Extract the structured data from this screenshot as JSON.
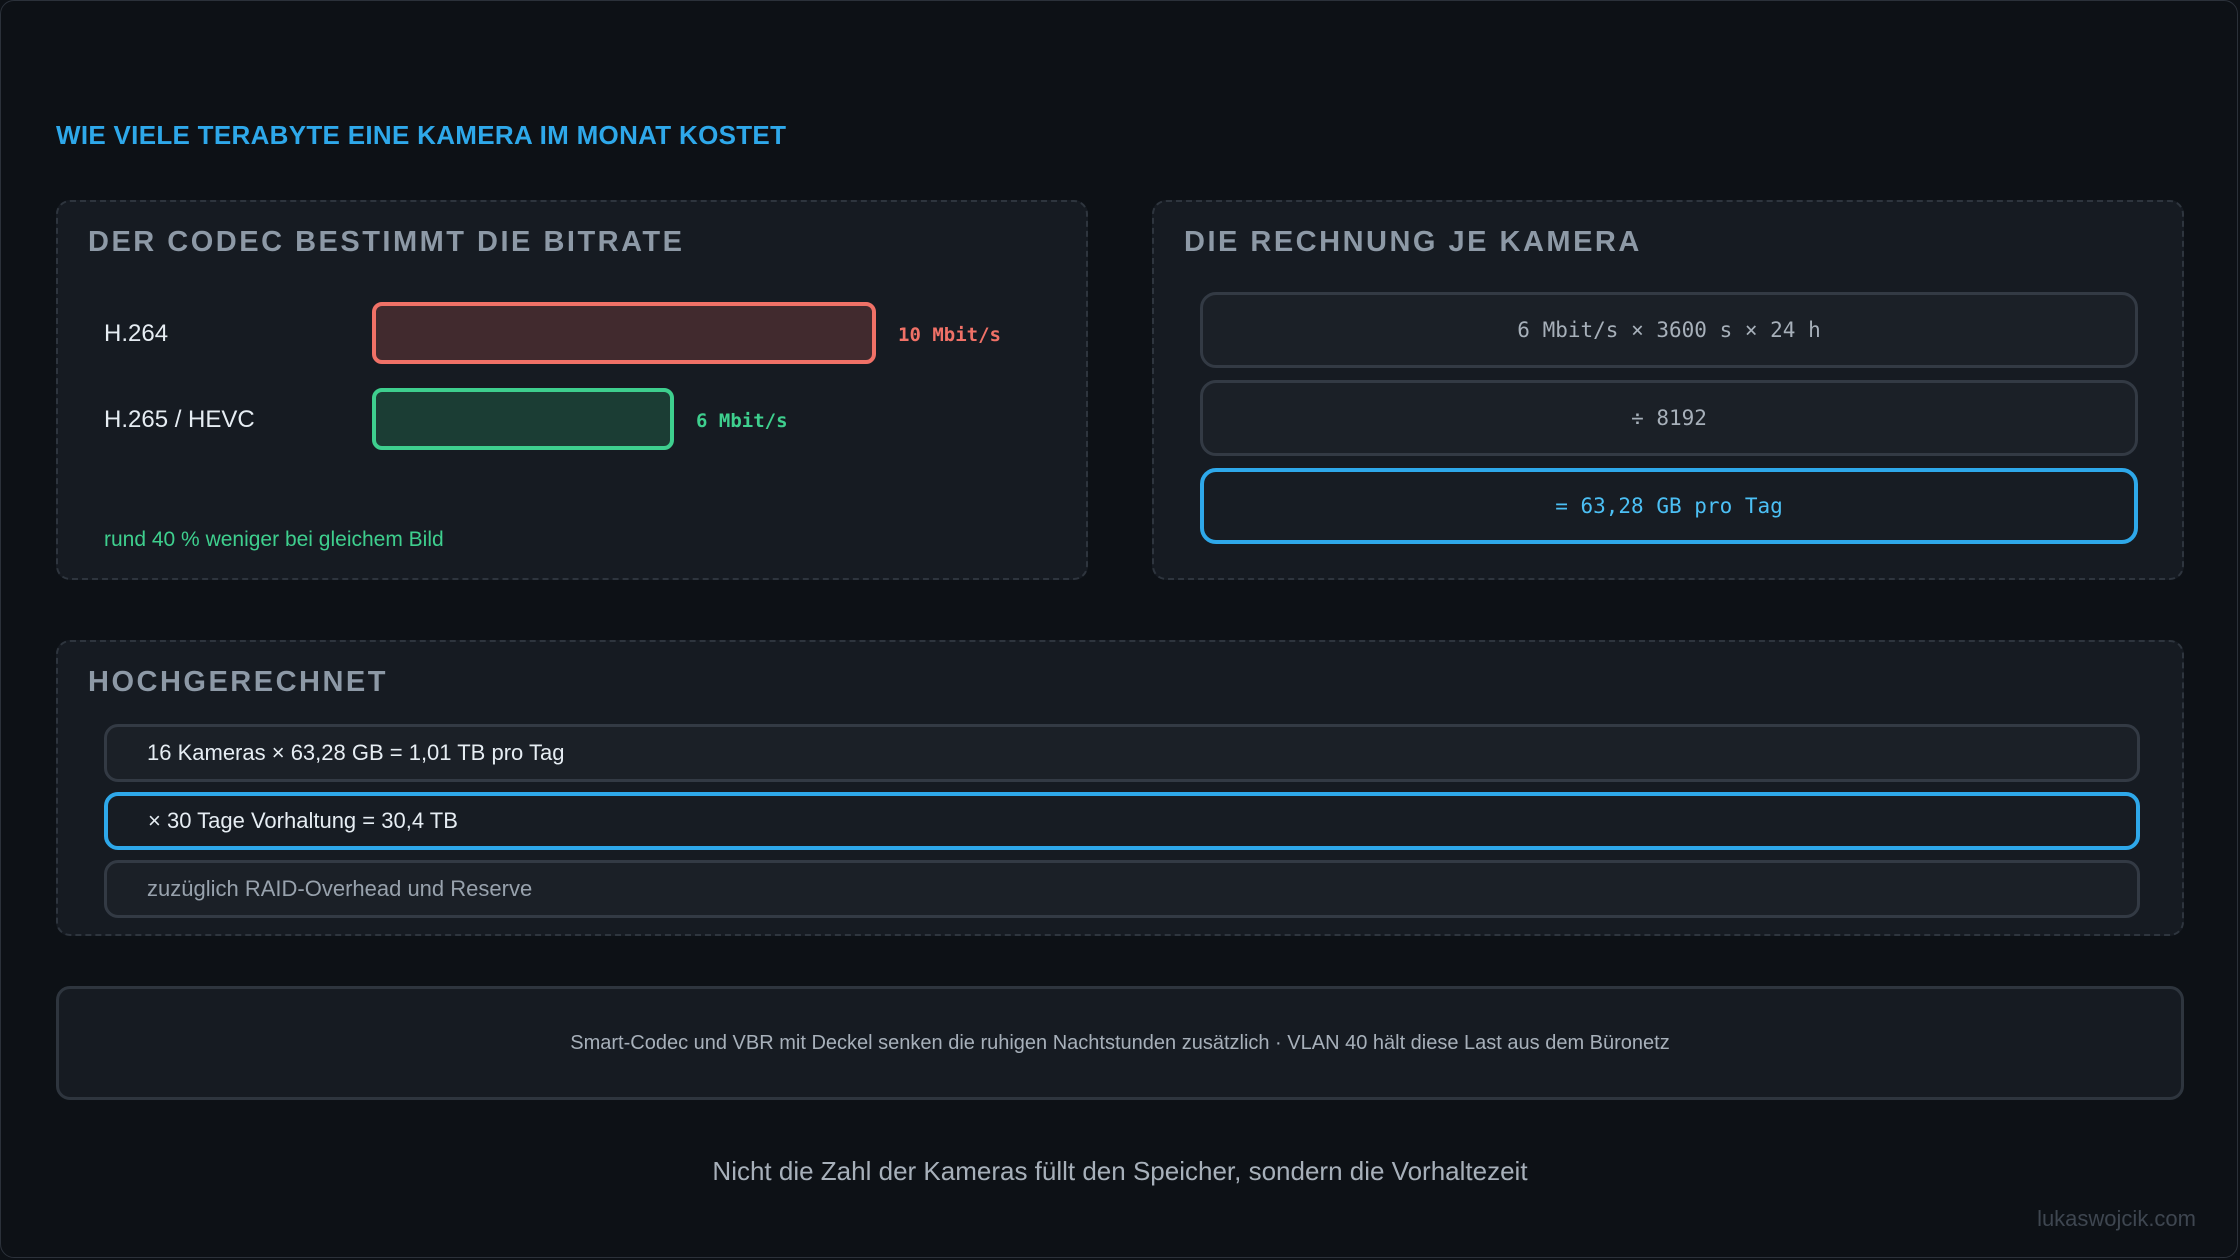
{
  "title": "WIE VIELE TERABYTE EINE KAMERA IM MONAT KOSTET",
  "codec_panel": {
    "title": "DER CODEC BESTIMMT DIE BITRATE",
    "codecs": [
      {
        "label": "H.264",
        "value_text": "10 Mbit/s",
        "bitrate": 10,
        "color": "#f07167",
        "fill": "#412a2e"
      },
      {
        "label": "H.265 / HEVC",
        "value_text": "6 Mbit/s",
        "bitrate": 6,
        "color": "#3ecf8e",
        "fill": "#1b3d34"
      }
    ],
    "note": "rund 40 % weniger bei gleichem Bild",
    "note_color": "#3ecf8e"
  },
  "calc_panel": {
    "title": "DIE RECHNUNG JE KAMERA",
    "steps": [
      "6 Mbit/s × 3600 s × 24 h",
      "÷ 8192",
      "= 63,28 GB pro Tag"
    ]
  },
  "scale_panel": {
    "title": "HOCHGERECHNET",
    "rows": [
      "16 Kameras × 63,28 GB = 1,01 TB pro Tag",
      "× 30 Tage Vorhaltung = 30,4 TB",
      "zuzüglich RAID-Overhead und Reserve"
    ]
  },
  "note": "Smart-Codec und VBR mit Deckel senken die ruhigen Nachtstunden zusätzlich · VLAN 40 hält diese Last aus dem Büronetz",
  "tagline": "Nicht die Zahl der Kameras füllt den Speicher, sondern die Vorhaltezeit",
  "credit": "lukaswojcik.com",
  "colors": {
    "accent": "#2ea8ea",
    "danger": "#f07167",
    "success": "#3ecf8e"
  }
}
